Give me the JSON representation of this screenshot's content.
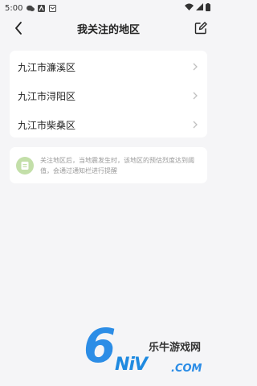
{
  "status_bar": {
    "time": "5:00",
    "icons": [
      "chat-icon",
      "nav-a-icon",
      "notification-icon"
    ],
    "right_icons": [
      "wifi-icon",
      "signal-icon",
      "battery-icon"
    ]
  },
  "header": {
    "title": "我关注的地区",
    "back_icon": "back-arrow-icon",
    "edit_icon": "edit-icon"
  },
  "regions": [
    {
      "label": "九江市濂溪区"
    },
    {
      "label": "九江市浔阳区"
    },
    {
      "label": "九江市柴桑区"
    }
  ],
  "info": {
    "text": "关注地区后，当地震发生时，该地区的预估烈度达到阈值，会通过通知栏进行提醒",
    "icon": "notice-icon"
  },
  "watermark": {
    "brand_cn": "乐牛游戏网",
    "brand_en": "NiV",
    "domain": ".COM",
    "digit": "6"
  },
  "colors": {
    "background": "#f5f5f7",
    "card": "#ffffff",
    "accent_green": "#c3dfa9",
    "watermark_blue": "#2c8de6"
  }
}
